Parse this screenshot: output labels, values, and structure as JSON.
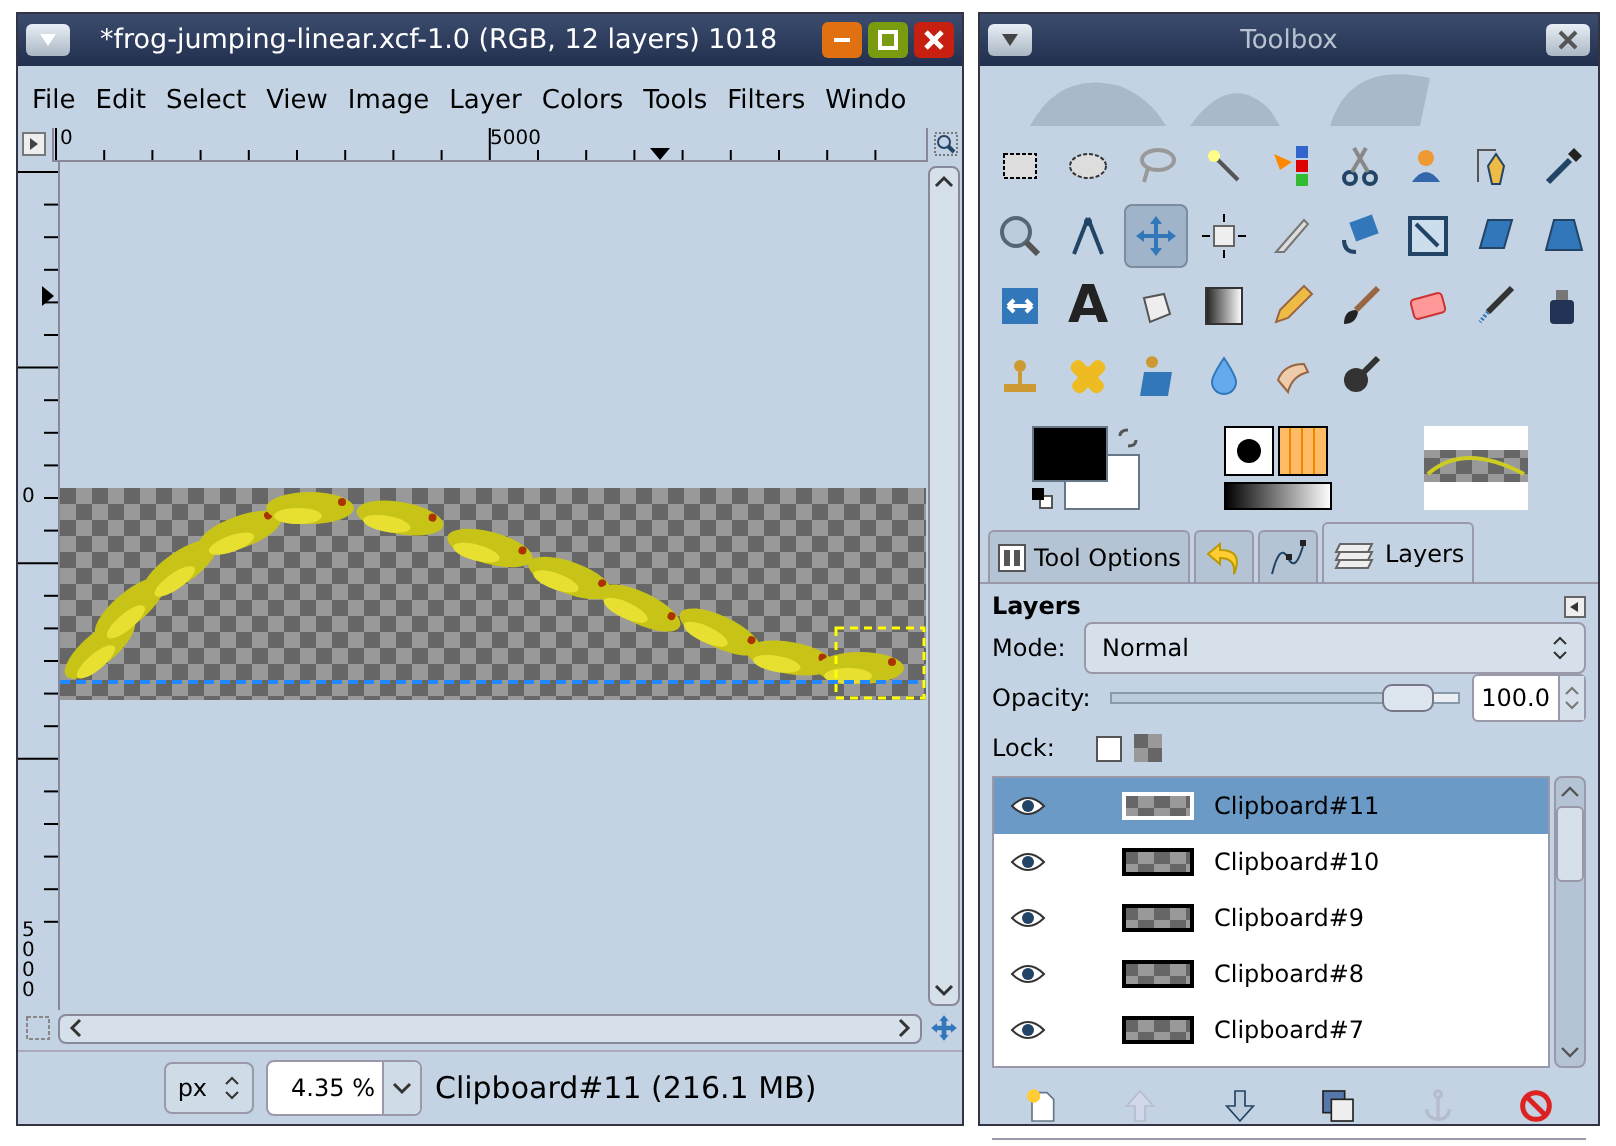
{
  "image_window": {
    "title": "*frog-jumping-linear.xcf-1.0 (RGB, 12 layers) 1018",
    "menu": [
      {
        "label": "File"
      },
      {
        "label": "Edit"
      },
      {
        "label": "Select"
      },
      {
        "label": "View"
      },
      {
        "label": "Image"
      },
      {
        "label": "Layer"
      },
      {
        "label": "Colors"
      },
      {
        "label": "Tools"
      },
      {
        "label": "Filters"
      },
      {
        "label": "Windo"
      }
    ],
    "hruler": [
      "0",
      "5000"
    ],
    "vruler": [
      "0",
      "5000"
    ],
    "unit": "px",
    "zoom": "4.35 %",
    "status": "Clipboard#11 (216.1 MB)"
  },
  "toolbox": {
    "title": "Toolbox",
    "tools": [
      {
        "selected": false
      },
      {
        "selected": false
      },
      {
        "selected": false
      },
      {
        "selected": false
      },
      {
        "selected": false
      },
      {
        "selected": false
      },
      {
        "selected": false
      },
      {
        "selected": false
      },
      {
        "selected": false
      },
      {
        "selected": false
      },
      {
        "selected": false
      },
      {
        "selected": true
      },
      {
        "selected": false
      },
      {
        "selected": false
      },
      {
        "selected": false
      },
      {
        "selected": false
      },
      {
        "selected": false
      },
      {
        "selected": false
      },
      {
        "selected": false
      },
      {
        "selected": false,
        "glyph": "A"
      },
      {
        "selected": false
      },
      {
        "selected": false
      },
      {
        "selected": false
      },
      {
        "selected": false
      },
      {
        "selected": false
      },
      {
        "selected": false
      },
      {
        "selected": false
      },
      {
        "selected": false
      },
      {
        "selected": false
      },
      {
        "selected": false
      },
      {
        "selected": false
      },
      {
        "selected": false
      },
      {
        "selected": false
      }
    ],
    "tabs": [
      {
        "kind": "text",
        "label": "Tool Options",
        "selected": false
      },
      {
        "kind": "undo",
        "selected": false
      },
      {
        "kind": "paths",
        "selected": false
      },
      {
        "kind": "text",
        "label": "Layers",
        "selected": true
      }
    ]
  },
  "layers_panel": {
    "heading": "Layers",
    "mode_label": "Mode:",
    "mode": "Normal",
    "opacity_label": "Opacity:",
    "opacity": {
      "level": 0.93,
      "value": "100.0"
    },
    "lock_label": "Lock:",
    "lock_pixels": {
      "checked": false
    },
    "layers": [
      {
        "name": "Clipboard#11",
        "selected": true,
        "visible": true
      },
      {
        "name": "Clipboard#10",
        "selected": false,
        "visible": true
      },
      {
        "name": "Clipboard#9",
        "selected": false,
        "visible": true
      },
      {
        "name": "Clipboard#8",
        "selected": false,
        "visible": true
      },
      {
        "name": "Clipboard#7",
        "selected": false,
        "visible": true
      }
    ],
    "actions": [
      {
        "kind": "new",
        "disabled": false
      },
      {
        "kind": "raise",
        "disabled": true
      },
      {
        "kind": "lower",
        "disabled": false
      },
      {
        "kind": "duplicate",
        "disabled": false
      },
      {
        "kind": "anchor",
        "disabled": true
      },
      {
        "kind": "delete",
        "disabled": false
      }
    ]
  }
}
